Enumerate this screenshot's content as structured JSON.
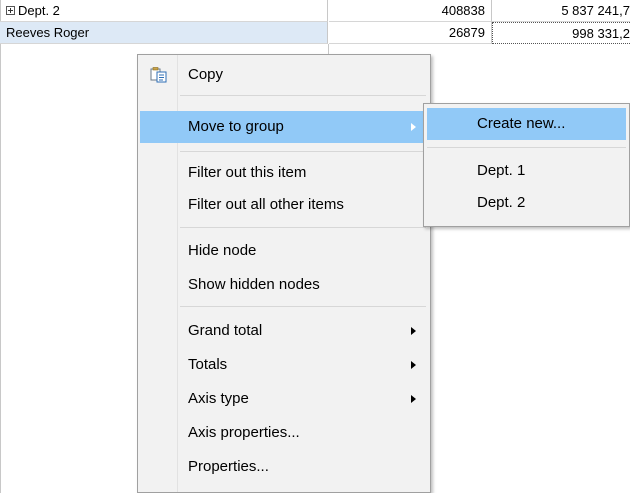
{
  "grid": {
    "rows": [
      {
        "label": "Dept. 2",
        "value1": "408838",
        "value2": "5 837 241,7",
        "group": true
      },
      {
        "label": "Reeves Roger",
        "value1": "26879",
        "value2": "998 331,2",
        "group": false
      }
    ]
  },
  "context_menu": {
    "copy": "Copy",
    "move_to_group": "Move to group",
    "filter_out_item": "Filter out this item",
    "filter_out_others": "Filter out all other items",
    "hide_node": "Hide node",
    "show_hidden_nodes": "Show hidden nodes",
    "grand_total": "Grand total",
    "totals": "Totals",
    "axis_type": "Axis type",
    "axis_properties": "Axis properties...",
    "properties": "Properties..."
  },
  "submenu": {
    "create_new": "Create new...",
    "dept1": "Dept. 1",
    "dept2": "Dept. 2"
  },
  "colors": {
    "menu_highlight": "#91c9f7",
    "selected_row": "#dde9f6"
  }
}
